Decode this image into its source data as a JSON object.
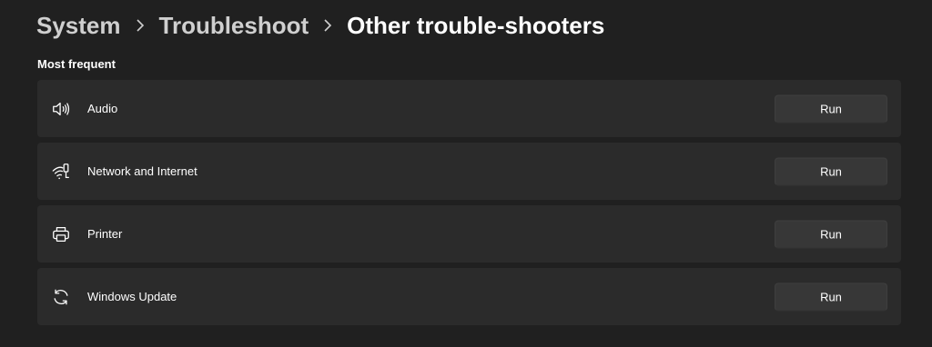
{
  "breadcrumb": {
    "items": [
      "System",
      "Troubleshoot",
      "Other trouble-shooters"
    ]
  },
  "section": {
    "title": "Most frequent"
  },
  "troubleshooters": [
    {
      "label": "Audio",
      "icon": "speaker-icon",
      "button": "Run"
    },
    {
      "label": "Network and Internet",
      "icon": "network-icon",
      "button": "Run"
    },
    {
      "label": "Printer",
      "icon": "printer-icon",
      "button": "Run"
    },
    {
      "label": "Windows Update",
      "icon": "sync-icon",
      "button": "Run"
    }
  ],
  "colors": {
    "background": "#202020",
    "card": "#2b2b2b",
    "button": "#373737",
    "text": "#ffffff",
    "breadcrumb_parent": "#cfcfcf"
  }
}
